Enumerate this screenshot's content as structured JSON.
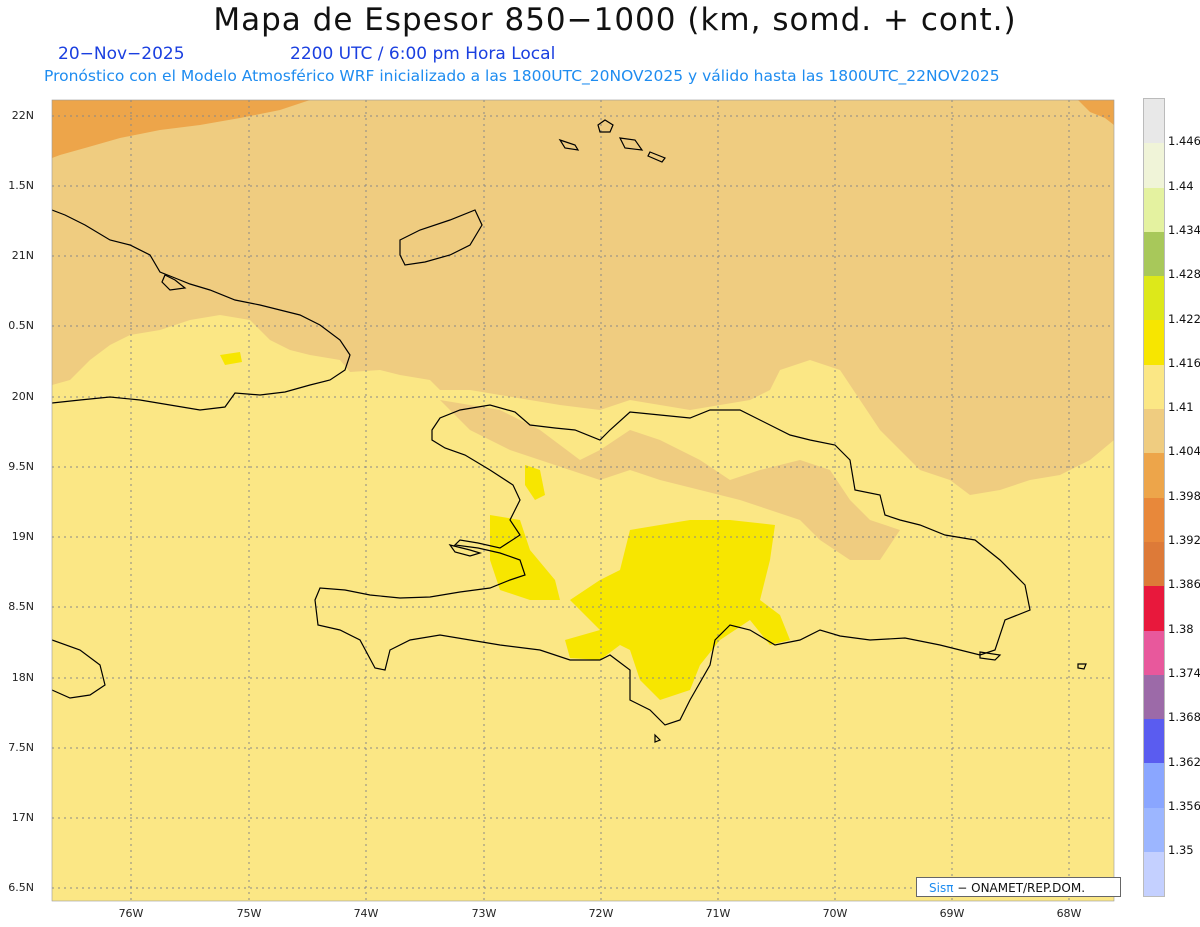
{
  "header": {
    "title": "Mapa de Espesor 850−1000 (km, somd. + cont.)",
    "date": "20−Nov−2025",
    "time": "2200 UTC / 6:00 pm Hora Local",
    "subtitle": "Pronóstico con el Modelo Atmosférico WRF inicializado a las 1800UTC_20NOV2025 y válido hasta las  1800UTC_22NOV2025"
  },
  "axes": {
    "lat_labels": [
      "22N",
      "1.5N",
      "21N",
      "0.5N",
      "20N",
      "9.5N",
      "19N",
      "8.5N",
      "18N",
      "7.5N",
      "17N",
      "6.5N"
    ],
    "lon_labels": [
      "76W",
      "75W",
      "74W",
      "73W",
      "72W",
      "71W",
      "70W",
      "69W",
      "68W"
    ]
  },
  "colorbar": {
    "labels": [
      "1.446",
      "1.44",
      "1.434",
      "1.428",
      "1.422",
      "1.416",
      "1.41",
      "1.404",
      "1.398",
      "1.392",
      "1.386",
      "1.38",
      "1.374",
      "1.368",
      "1.362",
      "1.356",
      "1.35"
    ],
    "colors": [
      "#e8e8e8",
      "#f0f4d8",
      "#e4f2a0",
      "#a8c85a",
      "#dde81a",
      "#f7e600",
      "#fbe785",
      "#efcc80",
      "#eda54a",
      "#e8883a",
      "#dd7a38",
      "#e8183c",
      "#e8589c",
      "#9c6aa8",
      "#5a5cf0",
      "#8aa6ff",
      "#9cb6ff",
      "#c4d0ff"
    ]
  },
  "credit": {
    "brand": "Sisπ",
    "text": " − ONAMET/REP.DOM."
  }
}
